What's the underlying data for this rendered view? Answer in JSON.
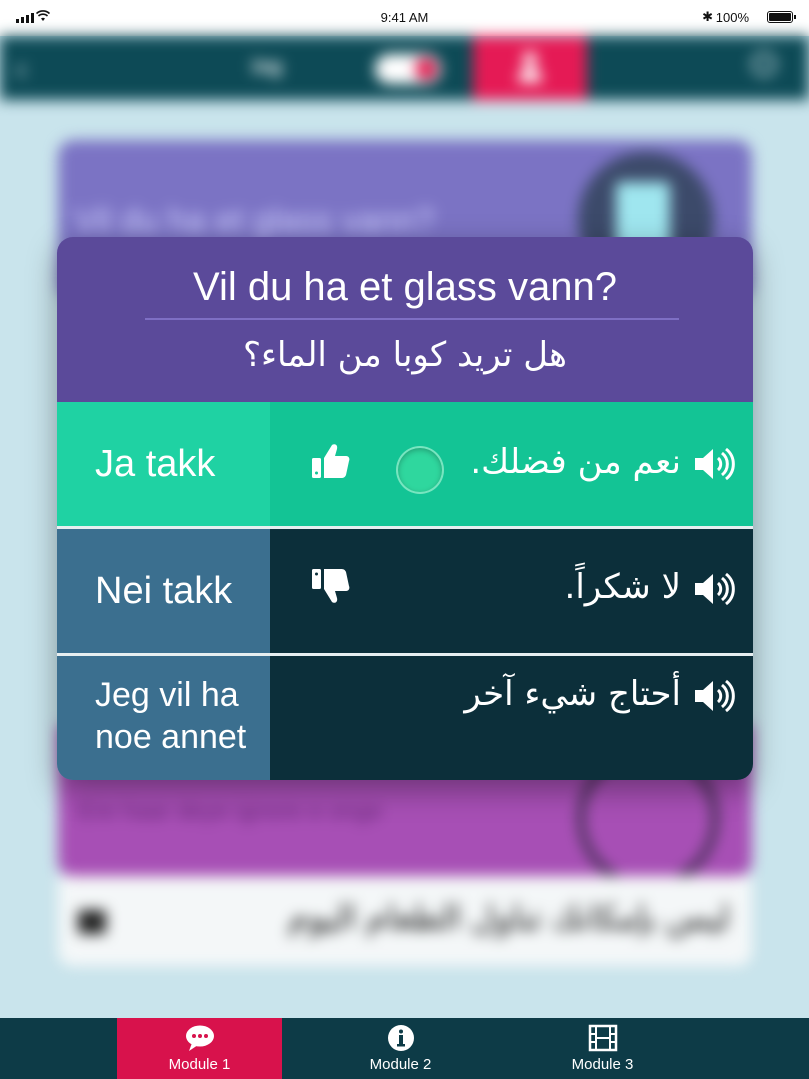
{
  "status_bar": {
    "time": "9:41 AM",
    "battery_percent": "100%",
    "icons": [
      "signal-icon",
      "wifi-icon",
      "bluetooth-icon",
      "battery-icon"
    ]
  },
  "background_app": {
    "top_bar": {
      "language": "ing",
      "icons": [
        "back-icon",
        "toggle-switch",
        "person-icon",
        "search-icon"
      ]
    },
    "card_question": "Vil du ha et glass vann?",
    "card_phrase": "Ere haar deye ignore e onge",
    "card_arabic": "ليس بإمكانك تناول الطعام اليوم"
  },
  "modal": {
    "question_no": "Vil du ha et glass vann?",
    "question_ar": "هل تريد كوبا من الماء؟",
    "options": [
      {
        "no": "Ja takk",
        "ar": "نعم من فضلك.",
        "icon": "thumbs-up-icon"
      },
      {
        "no": "Nei takk",
        "ar": "لا شكراً.",
        "icon": "thumbs-down-icon"
      },
      {
        "no_line1": "Jeg vil ha",
        "no_line2": "noe annet",
        "ar": "أحتاج شيء آخر"
      }
    ]
  },
  "tab_bar": {
    "tabs": [
      {
        "label": "Module 1",
        "icon": "chat-bubble-icon",
        "active": true
      },
      {
        "label": "Module 2",
        "icon": "info-icon",
        "active": false
      },
      {
        "label": "Module 3",
        "icon": "film-icon",
        "active": false
      }
    ]
  },
  "colors": {
    "accent": "#e51a55",
    "header_purple": "#5b4a9a",
    "yes_green": "#13c495",
    "dark_teal": "#0c2f3a",
    "label_blue": "#3b6f8f"
  }
}
